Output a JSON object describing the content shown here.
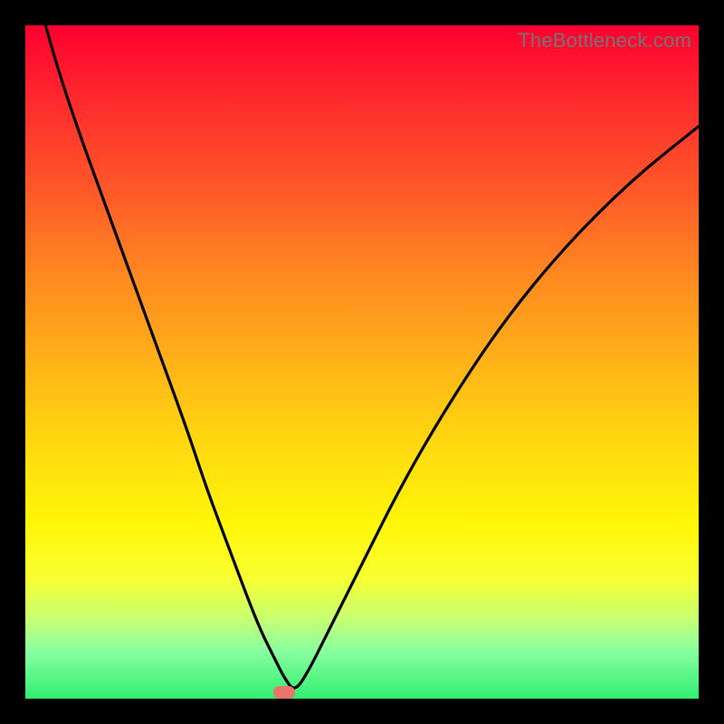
{
  "attribution": "TheBottleneck.com",
  "chart_data": {
    "type": "line",
    "title": "",
    "xlabel": "",
    "ylabel": "",
    "xlim": [
      0,
      100
    ],
    "ylim": [
      0,
      100
    ],
    "series": [
      {
        "name": "bottleneck-curve",
        "x": [
          3,
          5,
          8,
          12,
          16,
          20,
          24,
          27,
          30,
          33,
          35,
          37,
          38.5,
          40,
          42,
          45,
          50,
          56,
          63,
          71,
          80,
          90,
          100
        ],
        "values": [
          100,
          93,
          84,
          73,
          62,
          51,
          40,
          31,
          23,
          15,
          10,
          6,
          3,
          1,
          4,
          10,
          20,
          32,
          44,
          56,
          67,
          77,
          85
        ]
      }
    ],
    "marker": {
      "x": 38.5,
      "y": 1,
      "color": "#e8746a"
    },
    "gradient_stops": [
      {
        "pos": 0,
        "color": "#ff0030"
      },
      {
        "pos": 50,
        "color": "#ffb218"
      },
      {
        "pos": 82,
        "color": "#f8ff30"
      },
      {
        "pos": 100,
        "color": "#30ee70"
      }
    ]
  }
}
